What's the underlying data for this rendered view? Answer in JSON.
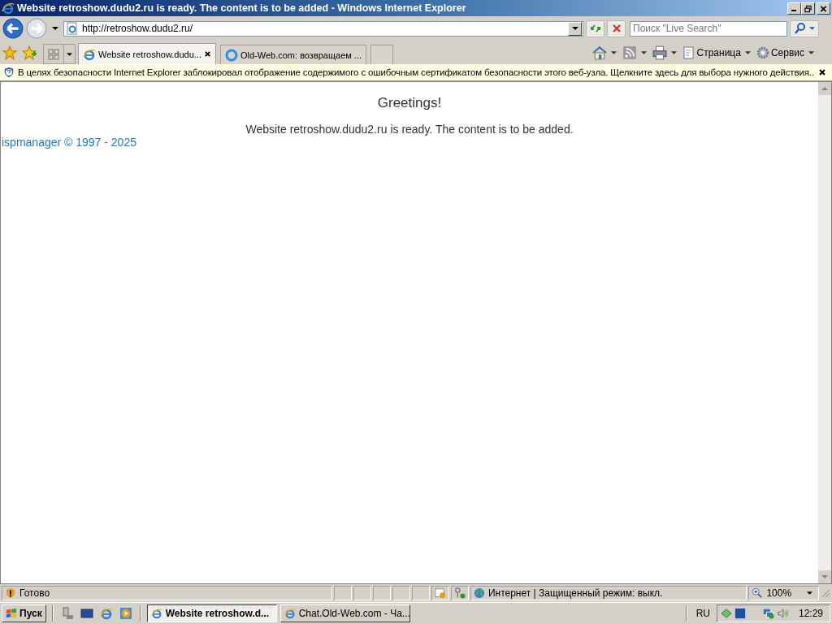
{
  "window": {
    "title": "Website retroshow.dudu2.ru is ready. The content is to be added - Windows Internet Explorer"
  },
  "address": {
    "url": "http://retroshow.dudu2.ru/"
  },
  "search": {
    "placeholder": "Поиск \"Live Search\""
  },
  "tabs": [
    {
      "label": "Website retroshow.dudu...",
      "selected": true
    },
    {
      "label": "Old-Web.com: возвращаем ...",
      "selected": false
    }
  ],
  "command_bar": [
    {
      "kind": "home"
    },
    {
      "kind": "feeds"
    },
    {
      "kind": "print"
    },
    {
      "kind": "page",
      "label": "Страница"
    },
    {
      "kind": "tools",
      "label": "Сервис"
    }
  ],
  "info_bar": {
    "text": "В целях безопасности Internet Explorer заблокировал отображение содержимого с ошибочным сертификатом безопасности этого веб-узла. Щелкните здесь для выбора нужного действия..."
  },
  "page": {
    "heading": "Greetings!",
    "message": "Website retroshow.dudu2.ru is ready. The content is to be added.",
    "footer_link": "ispmanager © 1997 - 2025"
  },
  "status_bar": {
    "text": "Готово",
    "zone": "Интернет | Защищенный режим: выкл.",
    "zoom": "100%"
  },
  "taskbar": {
    "start": "Пуск",
    "windows": [
      {
        "label": "Website retroshow.d...",
        "selected": true
      },
      {
        "label": "Chat.Old-Web.com - Ча...",
        "selected": false
      }
    ],
    "language": "RU",
    "clock": "12:29"
  }
}
